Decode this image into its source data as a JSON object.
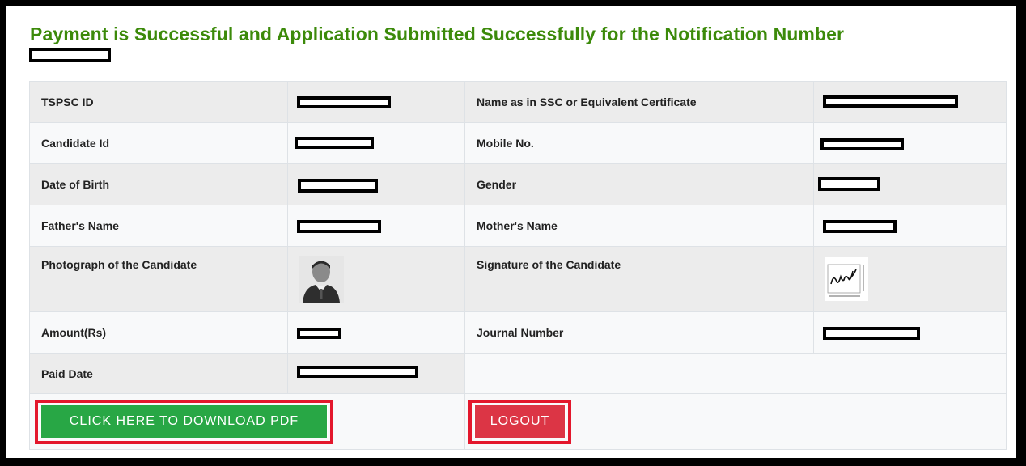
{
  "heading": "Payment is Successful and Application Submitted Successfully for the Notification Number",
  "fields": {
    "tspsc_id": "TSPSC ID",
    "name_ssc": "Name as in SSC or Equivalent Certificate",
    "candidate_id": "Candidate Id",
    "mobile": "Mobile No.",
    "dob": "Date of Birth",
    "gender": "Gender",
    "father": "Father's Name",
    "mother": "Mother's Name",
    "photo": "Photograph of the Candidate",
    "signature": "Signature of the Candidate",
    "amount": "Amount(Rs)",
    "journal": "Journal Number",
    "paid_date": "Paid Date"
  },
  "buttons": {
    "download": "CLICK HERE TO DOWNLOAD PDF",
    "logout": "LOGOUT"
  },
  "colors": {
    "heading": "#3c8a0a",
    "download_button": "#28a745",
    "logout_button": "#dc3545",
    "highlight_border": "#e3172c"
  },
  "icons": {
    "photo": "candidate-photo",
    "signature": "candidate-signature"
  }
}
